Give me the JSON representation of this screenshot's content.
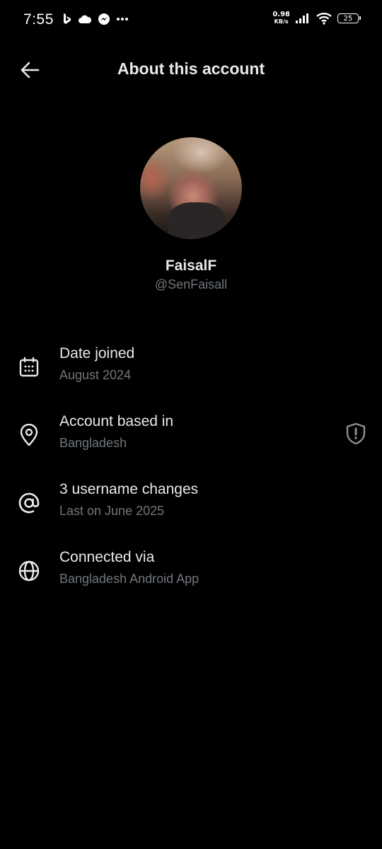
{
  "status_bar": {
    "time": "7:55",
    "net_speed_value": "0.98",
    "net_speed_unit": "KB/s",
    "battery": "25",
    "icons": [
      "bing-icon",
      "cloud-icon",
      "messenger-icon",
      "more-dots-icon",
      "signal-icon",
      "wifi-icon",
      "battery-icon"
    ]
  },
  "header": {
    "title": "About this account",
    "back_icon": "arrow-left-icon"
  },
  "profile": {
    "name": "FaisalF",
    "handle": "@SenFaisall"
  },
  "info_items": [
    {
      "icon": "calendar-icon",
      "label": "Date joined",
      "value": "August 2024"
    },
    {
      "icon": "location-pin-icon",
      "label": "Account based in",
      "value": "Bangladesh",
      "trailing_icon": "shield-alert-icon"
    },
    {
      "icon": "at-sign-icon",
      "label": "3 username changes",
      "value": "Last on June 2025"
    },
    {
      "icon": "globe-icon",
      "label": "Connected via",
      "value": "Bangladesh Android App"
    }
  ],
  "colors": {
    "background": "#000000",
    "primary_text": "#e7e9ea",
    "secondary_text": "#71767b",
    "shield": "#8b9095"
  }
}
